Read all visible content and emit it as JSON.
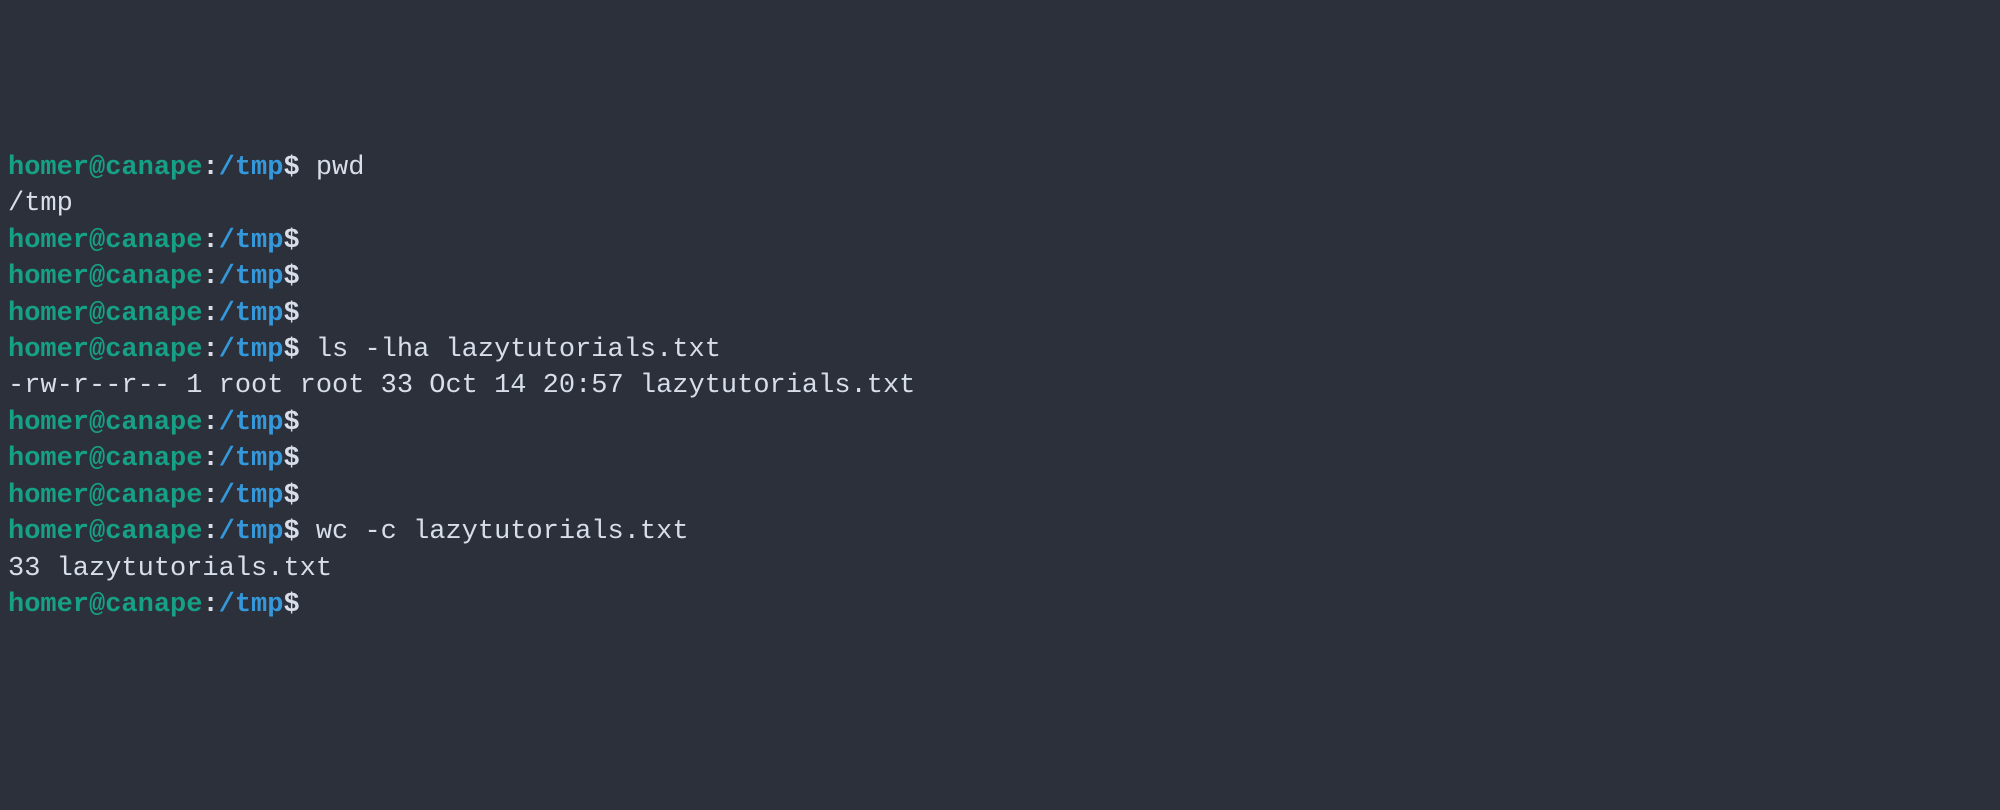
{
  "prompt": {
    "user": "homer@canape",
    "colon": ":",
    "path": "/tmp",
    "sigil": "$"
  },
  "lines": [
    {
      "type": "prompt",
      "command": " pwd"
    },
    {
      "type": "output",
      "text": "/tmp"
    },
    {
      "type": "prompt",
      "command": ""
    },
    {
      "type": "prompt",
      "command": ""
    },
    {
      "type": "prompt",
      "command": ""
    },
    {
      "type": "prompt",
      "command": " ls -lha lazytutorials.txt"
    },
    {
      "type": "output",
      "text": "-rw-r--r-- 1 root root 33 Oct 14 20:57 lazytutorials.txt"
    },
    {
      "type": "prompt",
      "command": ""
    },
    {
      "type": "prompt",
      "command": ""
    },
    {
      "type": "prompt",
      "command": ""
    },
    {
      "type": "prompt",
      "command": " wc -c lazytutorials.txt"
    },
    {
      "type": "output",
      "text": "33 lazytutorials.txt"
    },
    {
      "type": "prompt",
      "command": ""
    }
  ]
}
